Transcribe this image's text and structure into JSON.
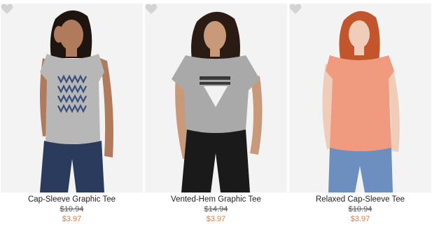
{
  "products": [
    {
      "name": "Cap-Sleeve Graphic Tee",
      "original_price": "$10.94",
      "sale_price": "$3.97",
      "shirt_color": "#b7b7b7",
      "skin": "#b07a5c",
      "hair": "#1e1510",
      "pants": "#2b3b5e"
    },
    {
      "name": "Vented-Hem Graphic Tee",
      "original_price": "$14.94",
      "sale_price": "$3.97",
      "shirt_color": "#a9a9a9",
      "skin": "#c99a7a",
      "hair": "#2a1c14",
      "pants": "#1a1a1a"
    },
    {
      "name": "Relaxed Cap-Sleeve Tee",
      "original_price": "$10.94",
      "sale_price": "$3.97",
      "shirt_color": "#f09a80",
      "skin": "#f0cdb8",
      "hair": "#c2552c",
      "pants": "#6c8fc0"
    }
  ],
  "icons": {
    "favorite": "heart-icon"
  },
  "colors": {
    "sale": "#e8792e",
    "heart": "#d3d3d3"
  }
}
